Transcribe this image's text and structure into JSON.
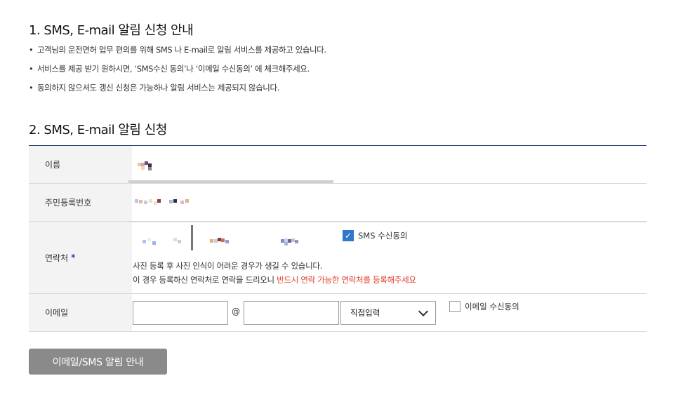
{
  "section1": {
    "title": "1. SMS, E-mail 알림 신청 안내",
    "notices": [
      "고객님의 운전면허 업무 편의를 위해 SMS 나 E-mail로 알림 서비스를 제공하고 있습니다.",
      "서비스를 제공 받기 원하시면, ‘SMS수신 동의’나 ‘이메일 수신동의’ 에 체크해주세요.",
      "동의하지 않으셔도 갱신 신청은 가능하나 알림 서비스는 제공되지 않습니다."
    ]
  },
  "section2": {
    "title": "2. SMS, E-mail 알림 신청",
    "labels": {
      "name": "이름",
      "rrn": "주민등록번호",
      "phone": "연락처",
      "required_mark": "*",
      "email": "이메일"
    },
    "phone_note": {
      "line1": "사진 등록 후 사진 인식이 어려운 경우가 생길 수 있습니다.",
      "line2_prefix": "이 경우 등록하신 연락처로 연락을 드리오니 ",
      "line2_warning": "반드시 연락 가능한 연락처를 등록해주세요"
    },
    "sms_consent": {
      "label": "SMS 수신동의",
      "checked": true
    },
    "email": {
      "user_value": "",
      "at_sign": "@",
      "domain_value": "",
      "domain_select": "직접입력"
    },
    "email_consent": {
      "label": "이메일 수신동의",
      "checked": false
    },
    "submit_label": "이메일/SMS 알림 안내"
  },
  "colors": {
    "accent": "#2f77c9",
    "warning": "#e0402f",
    "header_bg": "#f3f3f3",
    "top_border": "#1e3d6b",
    "button_bg": "#8a8a8a"
  }
}
